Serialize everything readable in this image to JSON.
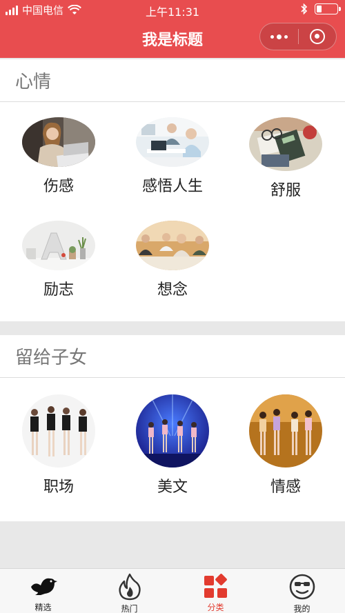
{
  "status_bar": {
    "carrier": "中国电信",
    "time": "上午11:31",
    "battery_level": 0.25
  },
  "nav": {
    "title": "我是标题"
  },
  "sections": [
    {
      "title": "心情",
      "items": [
        {
          "label": "伤感",
          "image": "woman-laptop-photo"
        },
        {
          "label": "感悟人生",
          "image": "office-workers-photo"
        },
        {
          "label": "舒服",
          "image": "desk-calculator-photo"
        },
        {
          "label": "励志",
          "image": "letter-a-decor-photo"
        },
        {
          "label": "想念",
          "image": "meeting-photo"
        }
      ]
    },
    {
      "title": "留给子女",
      "items": [
        {
          "label": "职场",
          "image": "dancers-white-photo"
        },
        {
          "label": "美文",
          "image": "stage-performance-photo"
        },
        {
          "label": "情感",
          "image": "dancers-stage-photo"
        }
      ]
    }
  ],
  "tabbar": {
    "items": [
      {
        "label": "精选",
        "icon": "bird-icon"
      },
      {
        "label": "热门",
        "icon": "flame-icon"
      },
      {
        "label": "分类",
        "icon": "category-icon",
        "active": true
      },
      {
        "label": "我的",
        "icon": "smiley-icon"
      }
    ]
  },
  "colors": {
    "brand": "#e84d4f",
    "tab_active": "#e23b2f"
  }
}
